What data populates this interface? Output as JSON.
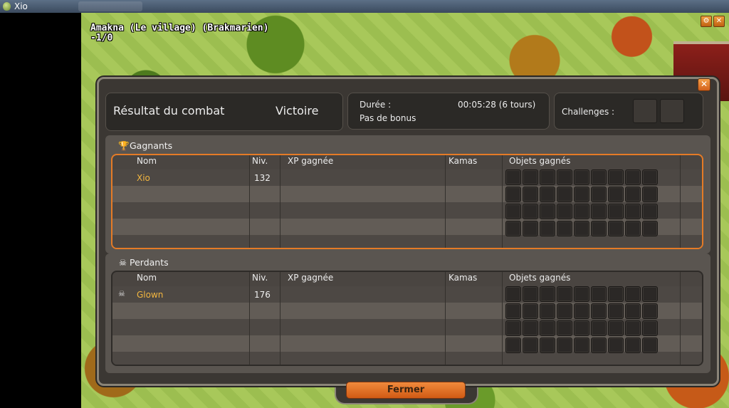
{
  "window": {
    "title": "Xio"
  },
  "map": {
    "location": "Amakna (Le village) (Brakmarien)",
    "coords": "-1/0"
  },
  "dialog": {
    "result_label": "Résultat du combat",
    "result_value": "Victoire",
    "duration_label": "Durée :",
    "duration_value": "00:05:28 (6 tours)",
    "bonus": "Pas de bonus",
    "challenges_label": "Challenges :",
    "close_label": "Fermer"
  },
  "columns": {
    "name": "Nom",
    "level": "Niv.",
    "xp": "XP gagnée",
    "kamas": "Kamas",
    "items": "Objets gagnés"
  },
  "winners": {
    "title": "Gagnants",
    "rows": [
      {
        "name": "Xio",
        "level": "132"
      }
    ]
  },
  "losers": {
    "title": "Perdants",
    "rows": [
      {
        "name": "Glown",
        "level": "176"
      }
    ]
  },
  "colors": {
    "accent_orange": "#e57b26",
    "name_gold": "#f2b640",
    "panel_dark": "#3b3733"
  },
  "icons": {
    "winners": "trophy-icon",
    "losers": "skull-icon",
    "close": "close-icon"
  }
}
